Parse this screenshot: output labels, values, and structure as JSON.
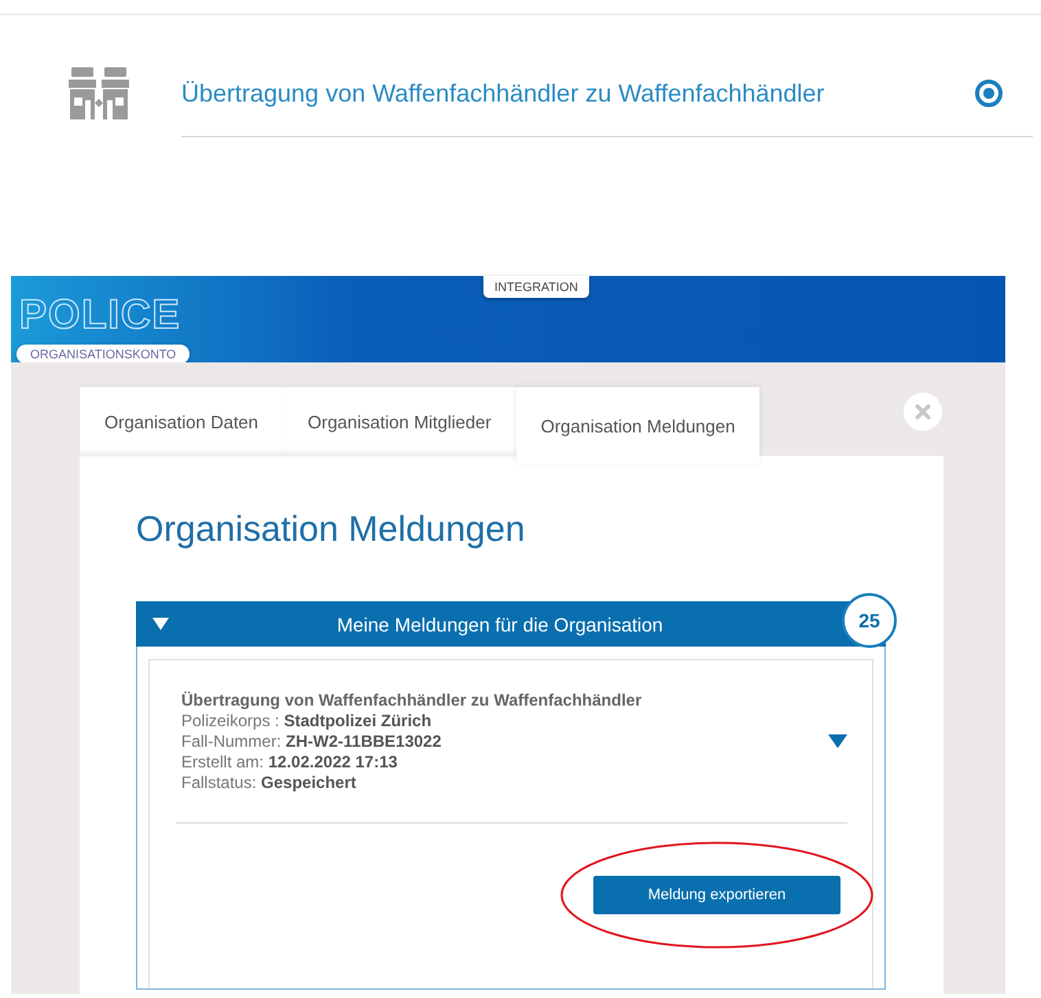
{
  "option": {
    "label": "Übertragung von Waffenfachhändler zu Waffenfachhändler",
    "selected": true
  },
  "banner": {
    "logo": "POLICE",
    "environment": "INTEGRATION",
    "account": "ORGANISATIONSKONTO"
  },
  "tabs": [
    {
      "label": "Organisation Daten",
      "selected": false
    },
    {
      "label": "Organisation Mitglieder",
      "selected": false
    },
    {
      "label": "Organisation Meldungen",
      "selected": true
    }
  ],
  "panel": {
    "title": "Organisation Meldungen",
    "accordion": {
      "title": "Meine Meldungen für die Organisation",
      "count": "25",
      "expanded": true,
      "items": [
        {
          "title": "Übertragung von Waffenfachhändler zu Waffenfachhändler",
          "expanded": false,
          "fields": [
            {
              "label": "Polizeikorps : ",
              "value": "Stadtpolizei Zürich"
            },
            {
              "label": "Fall-Nummer: ",
              "value": "ZH-W2-11BBE13022"
            },
            {
              "label": "Erstellt am: ",
              "value": "12.02.2022 17:13"
            },
            {
              "label": "Fallstatus: ",
              "value": "Gespeichert"
            }
          ],
          "action": "Meldung exportieren",
          "highlighted": true
        }
      ]
    }
  }
}
